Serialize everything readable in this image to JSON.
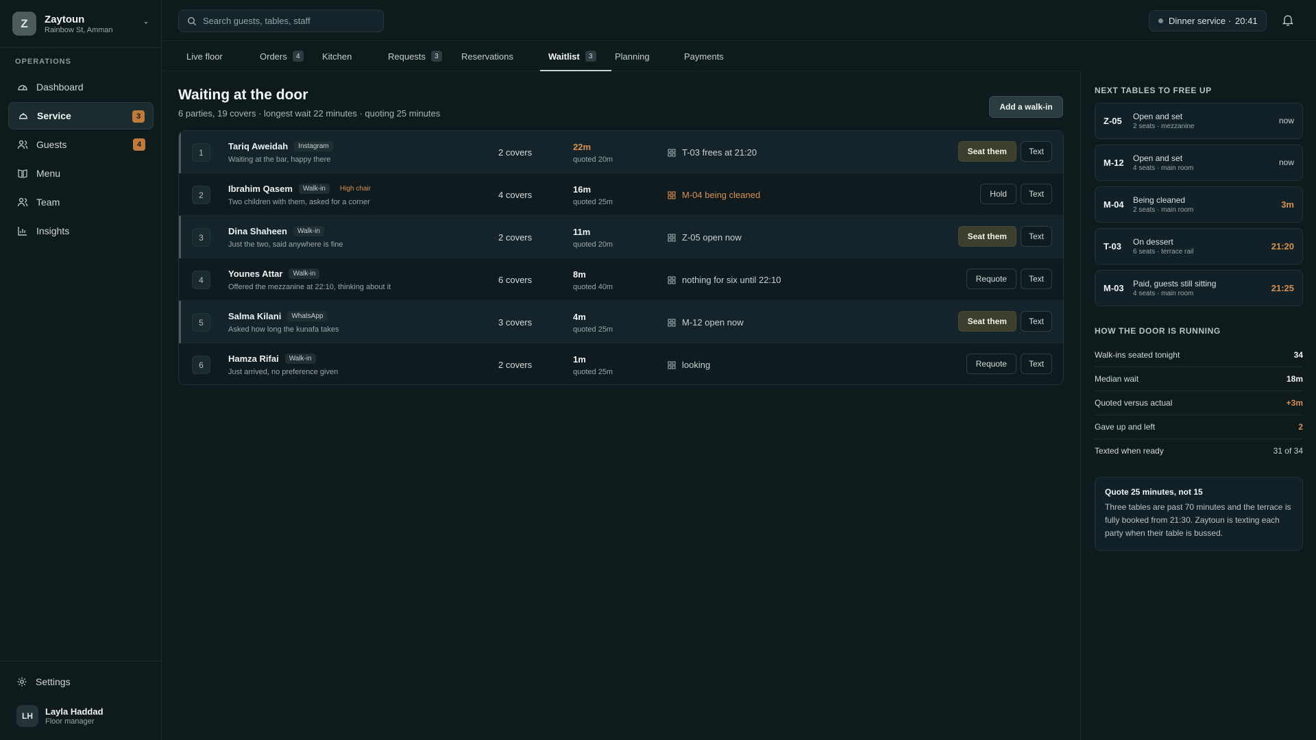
{
  "brand": {
    "initial": "Z",
    "name": "Zaytoun",
    "location": "Rainbow St, Amman"
  },
  "sidebar": {
    "section": "OPERATIONS",
    "items": [
      {
        "label": "Dashboard",
        "icon": "dashboard-icon"
      },
      {
        "label": "Service",
        "icon": "service-bell-icon",
        "badge": "3",
        "active": true
      },
      {
        "label": "Guests",
        "icon": "guests-icon",
        "badge": "4"
      },
      {
        "label": "Menu",
        "icon": "menu-book-icon"
      },
      {
        "label": "Team",
        "icon": "team-icon"
      },
      {
        "label": "Insights",
        "icon": "chart-icon"
      }
    ],
    "settings_label": "Settings",
    "user": {
      "initials": "LH",
      "name": "Layla Haddad",
      "role": "Floor manager"
    }
  },
  "topbar": {
    "search_placeholder": "Search guests, tables, staff",
    "service": "Dinner service ·",
    "time": "20:41"
  },
  "tabs": [
    {
      "label": "Live floor"
    },
    {
      "label": "Orders",
      "count": "4"
    },
    {
      "label": "Kitchen"
    },
    {
      "label": "Requests",
      "count": "3"
    },
    {
      "label": "Reservations"
    },
    {
      "label": "Waitlist",
      "count": "3",
      "active": true
    },
    {
      "label": "Planning"
    },
    {
      "label": "Payments"
    }
  ],
  "main": {
    "title": "Waiting at the door",
    "subtitle": "6 parties, 19 covers · longest wait 22 minutes · quoting 25 minutes",
    "add_walkin": "Add a walk-in"
  },
  "waitlist": [
    {
      "pos": "1",
      "name": "Tariq Aweidah",
      "tags": [
        "Instagram"
      ],
      "note": "Waiting at the bar, happy there",
      "covers": "2 covers",
      "wait": "22m",
      "quoted": "quoted 20m",
      "table": "T-03 frees at 21:20",
      "primary": "Seat them",
      "text": "Text"
    },
    {
      "pos": "2",
      "name": "Ibrahim Qasem",
      "tags": [
        "Walk-in"
      ],
      "warn_tag": "High chair",
      "note": "Two children with them, asked for a corner",
      "covers": "4 covers",
      "wait": "16m",
      "quoted": "quoted 25m",
      "table": "M-04 being cleaned",
      "secondary": "Hold",
      "text": "Text"
    },
    {
      "pos": "3",
      "name": "Dina Shaheen",
      "tags": [
        "Walk-in"
      ],
      "note": "Just the two, said anywhere is fine",
      "covers": "2 covers",
      "wait": "11m",
      "quoted": "quoted 20m",
      "table": "Z-05 open now",
      "primary": "Seat them",
      "text": "Text"
    },
    {
      "pos": "4",
      "name": "Younes Attar",
      "tags": [
        "Walk-in"
      ],
      "note": "Offered the mezzanine at 22:10, thinking about it",
      "covers": "6 covers",
      "wait": "8m",
      "quoted": "quoted 40m",
      "table": "nothing for six until 22:10",
      "secondary": "Requote",
      "text": "Text"
    },
    {
      "pos": "5",
      "name": "Salma Kilani",
      "tags": [
        "WhatsApp"
      ],
      "note": "Asked how long the kunafa takes",
      "covers": "3 covers",
      "wait": "4m",
      "quoted": "quoted 25m",
      "table": "M-12 open now",
      "primary": "Seat them",
      "text": "Text"
    },
    {
      "pos": "6",
      "name": "Hamza Rifai",
      "tags": [
        "Walk-in"
      ],
      "note": "Just arrived, no preference given",
      "covers": "2 covers",
      "wait": "1m",
      "quoted": "quoted 25m",
      "table": "looking",
      "secondary": "Requote",
      "text": "Text"
    }
  ],
  "right_panel": {
    "free_title": "NEXT TABLES TO FREE UP",
    "free_tables": [
      {
        "code": "Z-05",
        "status": "Open and set",
        "detail": "2 seats · mezzanine",
        "time": "now"
      },
      {
        "code": "M-12",
        "status": "Open and set",
        "detail": "4 seats · main room",
        "time": "now"
      },
      {
        "code": "M-04",
        "status": "Being cleaned",
        "detail": "2 seats · main room",
        "time": "3m"
      },
      {
        "code": "T-03",
        "status": "On dessert",
        "detail": "6 seats · terrace rail",
        "time": "21:20"
      },
      {
        "code": "M-03",
        "status": "Paid, guests still sitting",
        "detail": "4 seats · main room",
        "time": "21:25"
      }
    ],
    "stats_title": "HOW THE DOOR IS RUNNING",
    "stats": [
      {
        "label": "Walk-ins seated tonight",
        "value": "34"
      },
      {
        "label": "Median wait",
        "value": "18m"
      },
      {
        "label": "Quoted versus actual",
        "value": "+3m"
      },
      {
        "label": "Gave up and left",
        "value": "2"
      },
      {
        "label": "Texted when ready",
        "value": "31 of 34"
      }
    ],
    "note": {
      "title": "Quote 25 minutes, not 15",
      "body": "Three tables are past 70 minutes and the terrace is fully booked from 21:30. Zaytoun is texting each party when their table is bussed."
    }
  },
  "colors": {
    "background": "#0f1a1d",
    "accent_warn": "#d9914f",
    "primary_button": "#3d3f2e"
  }
}
